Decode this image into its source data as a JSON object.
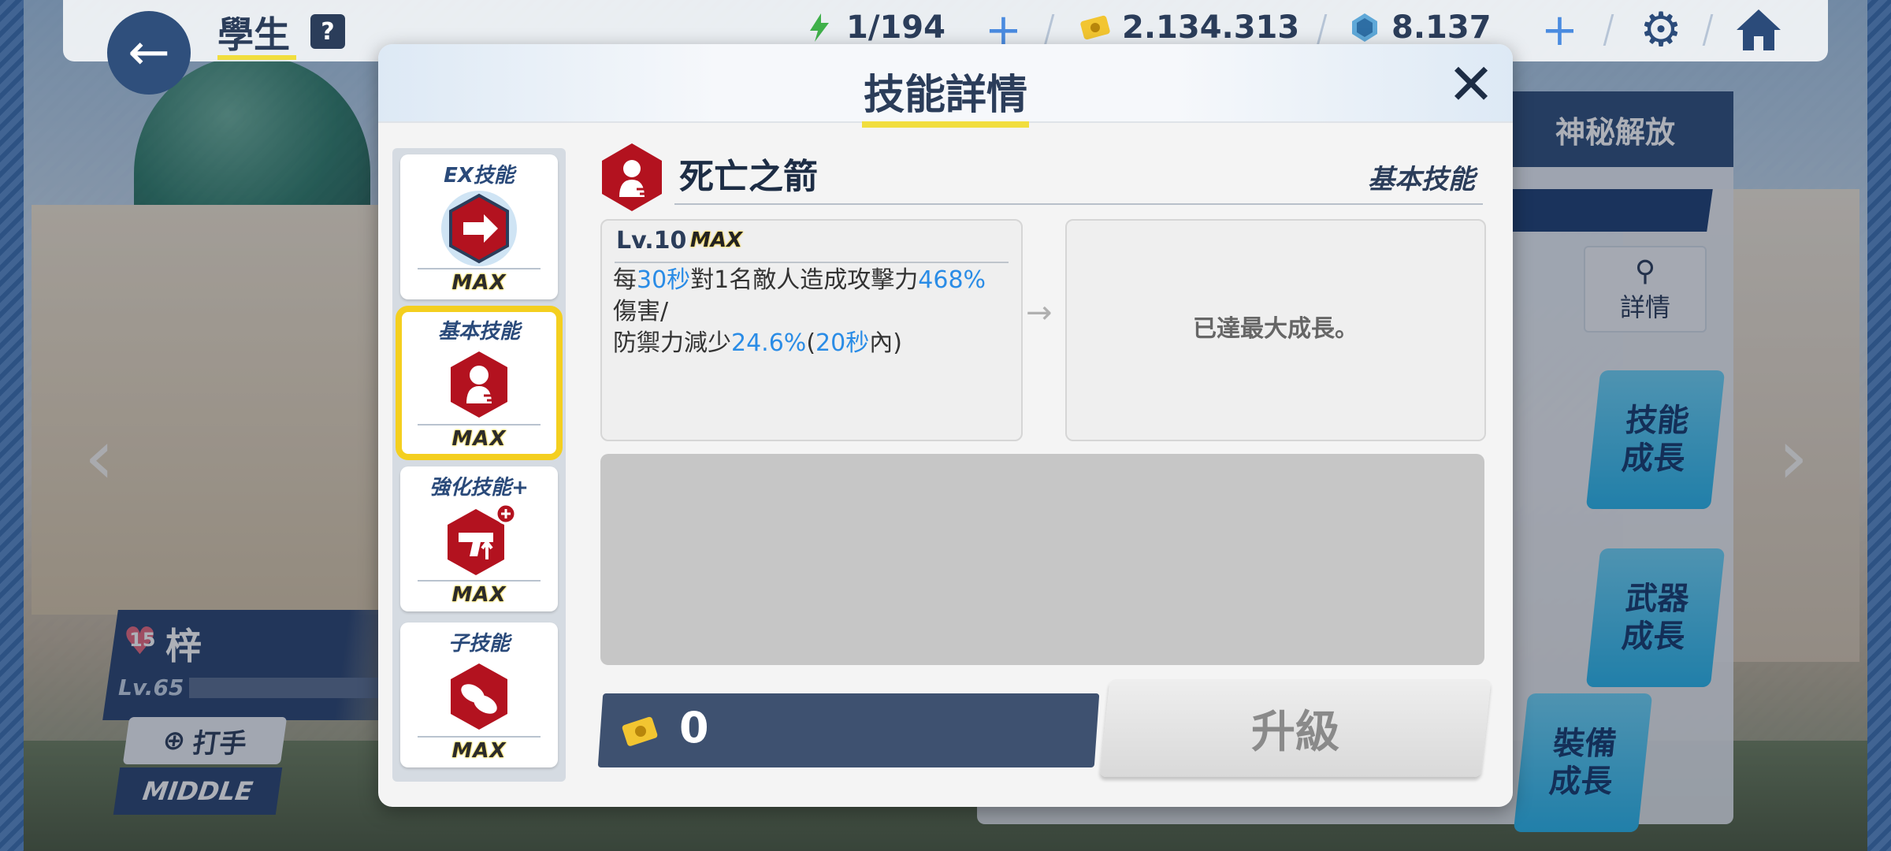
{
  "topbar": {
    "title": "學生",
    "help": "?",
    "ap": "1/194",
    "credits": "2.134.313",
    "gems": "8.137"
  },
  "background": {
    "mystic_tab": "神秘解放",
    "detail_label": "詳情",
    "skill_growth": "技能\n成長",
    "weapon_growth": "武器\n成長",
    "gear_growth": "裝備\n成長",
    "char_affection": "15",
    "char_name": "梓",
    "char_level": "Lv.65",
    "role": "打手",
    "position": "MIDDLE"
  },
  "modal": {
    "title": "技能詳情",
    "tabs": [
      {
        "label": "EX技能",
        "max": "MAX",
        "icon": "ex-skill-icon"
      },
      {
        "label": "基本技能",
        "max": "MAX",
        "icon": "basic-skill-icon"
      },
      {
        "label": "強化技能+",
        "max": "MAX",
        "icon": "enhanced-skill-icon"
      },
      {
        "label": "子技能",
        "max": "MAX",
        "icon": "sub-skill-icon"
      }
    ],
    "skill": {
      "name": "死亡之箭",
      "type": "基本技能",
      "level": "Lv.10",
      "max": "MAX",
      "desc_parts": [
        "每",
        "30秒",
        "對1名敵人造成攻擊力",
        "468%",
        "傷害/",
        "防禦力減少",
        "24.6%",
        "(",
        "20秒",
        "內)"
      ],
      "next": "已達最大成長。"
    },
    "cost": "0",
    "upgrade": "升級"
  },
  "colors": {
    "accent_yellow": "#f1de3e",
    "highlight_blue": "#2a8ce6",
    "skill_red": "#b3121f",
    "navy": "#2b3d5a"
  }
}
